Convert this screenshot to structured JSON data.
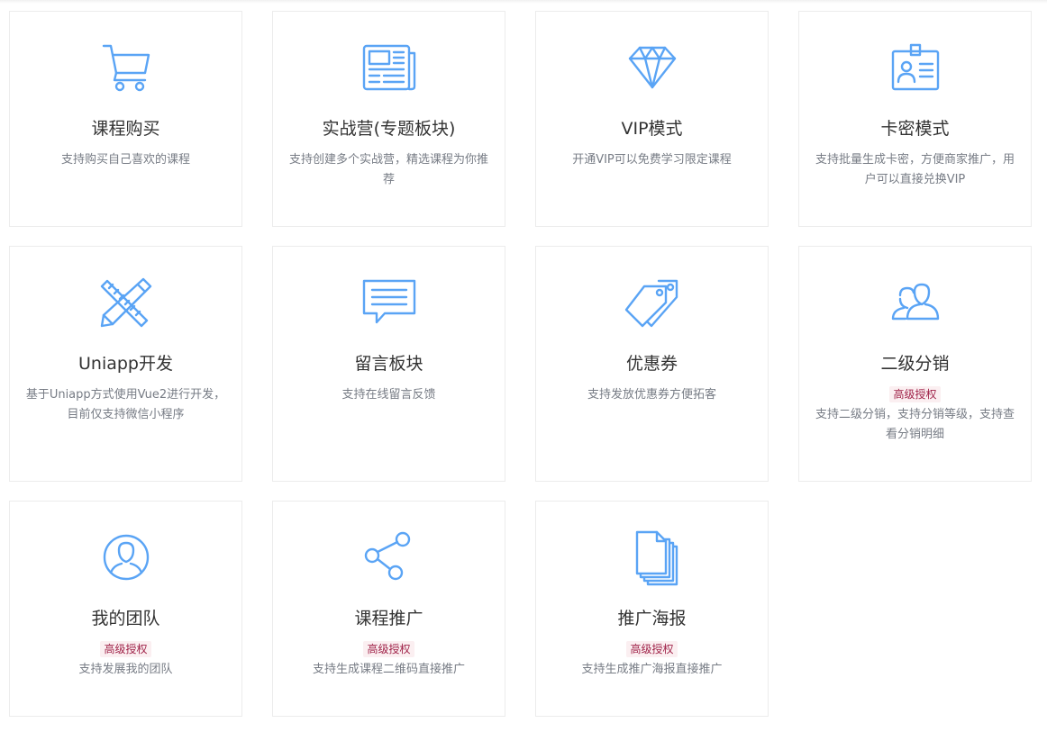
{
  "badge_label": "高级授权",
  "accent_color": "#5aa4f5",
  "cards": [
    {
      "icon": "shopping-cart-icon",
      "title": "课程购买",
      "desc": "支持购买自己喜欢的课程",
      "badge": false
    },
    {
      "icon": "newspaper-icon",
      "title": "实战营(专题板块)",
      "desc": "支持创建多个实战营，精选课程为你推荐",
      "badge": false
    },
    {
      "icon": "diamond-icon",
      "title": "VIP模式",
      "desc": "开通VIP可以免费学习限定课程",
      "badge": false
    },
    {
      "icon": "id-card-icon",
      "title": "卡密模式",
      "desc": "支持批量生成卡密，方便商家推广，用户可以直接兑换VIP",
      "badge": false
    },
    {
      "icon": "pencil-ruler-icon",
      "title": "Uniapp开发",
      "desc": "基于Uniapp方式使用Vue2进行开发，目前仅支持微信小程序",
      "badge": false
    },
    {
      "icon": "message-board-icon",
      "title": "留言板块",
      "desc": "支持在线留言反馈",
      "badge": false
    },
    {
      "icon": "coupon-tags-icon",
      "title": "优惠券",
      "desc": "支持发放优惠券方便拓客",
      "badge": false
    },
    {
      "icon": "users-icon",
      "title": "二级分销",
      "desc": "支持二级分销，支持分销等级，支持查看分销明细",
      "badge": true
    },
    {
      "icon": "user-circle-icon",
      "title": "我的团队",
      "desc": "支持发展我的团队",
      "badge": true
    },
    {
      "icon": "share-icon",
      "title": "课程推广",
      "desc": "支持生成课程二维码直接推广",
      "badge": true
    },
    {
      "icon": "documents-icon",
      "title": "推广海报",
      "desc": "支持生成推广海报直接推广",
      "badge": true
    }
  ]
}
